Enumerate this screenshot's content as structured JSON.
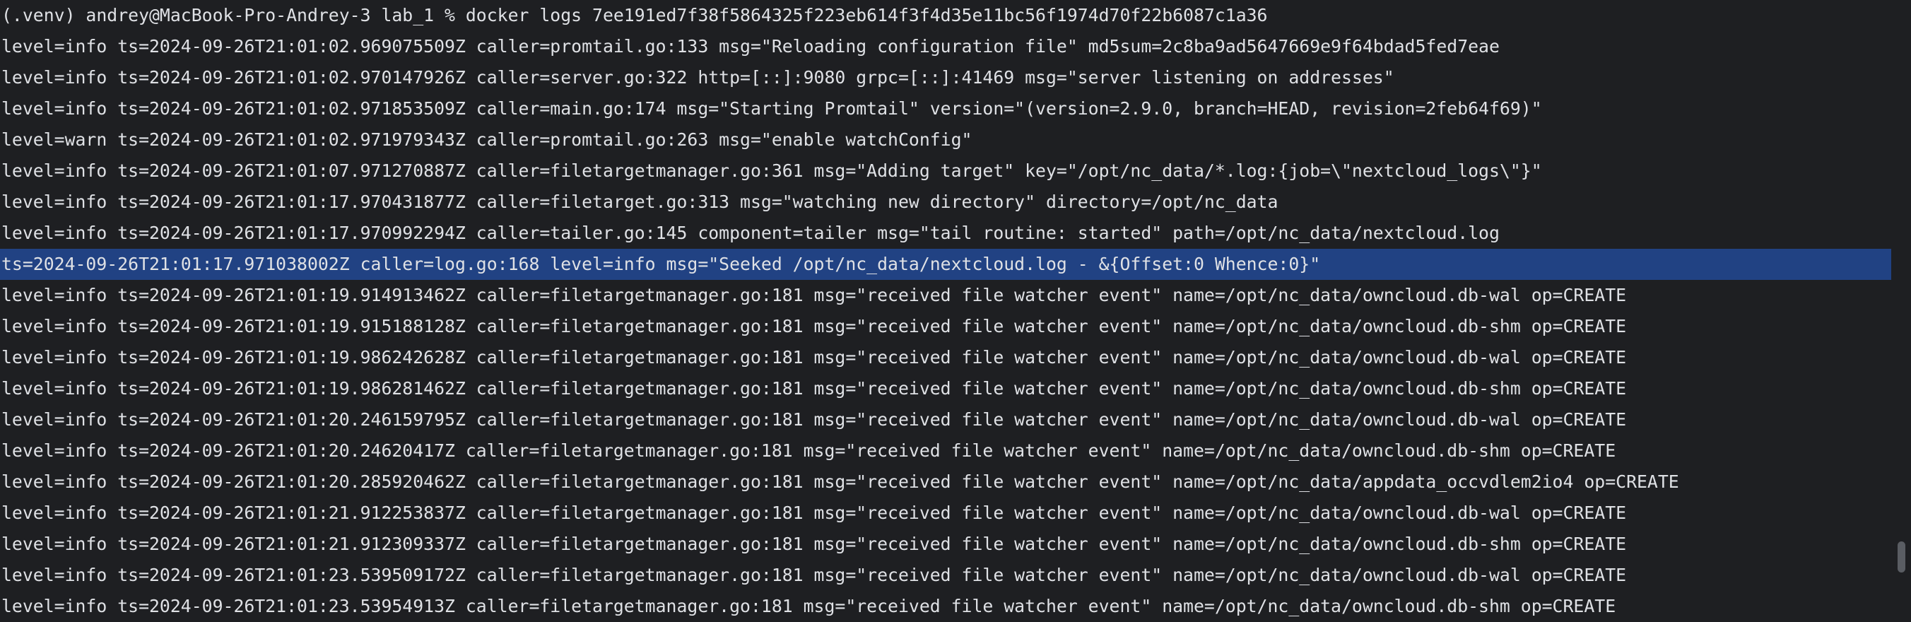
{
  "terminal": {
    "prompt_line": "(.venv) andrey@MacBook-Pro-Andrey-3 lab_1 % docker logs 7ee191ed7f38f5864325f223eb614f3f4d35e11bc56f1974d70f22b6087c1a36",
    "log_lines": [
      "level=info ts=2024-09-26T21:01:02.969075509Z caller=promtail.go:133 msg=\"Reloading configuration file\" md5sum=2c8ba9ad5647669e9f64bdad5fed7eae",
      "level=info ts=2024-09-26T21:01:02.970147926Z caller=server.go:322 http=[::]:9080 grpc=[::]:41469 msg=\"server listening on addresses\"",
      "level=info ts=2024-09-26T21:01:02.971853509Z caller=main.go:174 msg=\"Starting Promtail\" version=\"(version=2.9.0, branch=HEAD, revision=2feb64f69)\"",
      "level=warn ts=2024-09-26T21:01:02.971979343Z caller=promtail.go:263 msg=\"enable watchConfig\"",
      "level=info ts=2024-09-26T21:01:07.971270887Z caller=filetargetmanager.go:361 msg=\"Adding target\" key=\"/opt/nc_data/*.log:{job=\\\"nextcloud_logs\\\"}\"",
      "level=info ts=2024-09-26T21:01:17.970431877Z caller=filetarget.go:313 msg=\"watching new directory\" directory=/opt/nc_data",
      "level=info ts=2024-09-26T21:01:17.970992294Z caller=tailer.go:145 component=tailer msg=\"tail routine: started\" path=/opt/nc_data/nextcloud.log",
      "ts=2024-09-26T21:01:17.971038002Z caller=log.go:168 level=info msg=\"Seeked /opt/nc_data/nextcloud.log - &{Offset:0 Whence:0}\"",
      "level=info ts=2024-09-26T21:01:19.914913462Z caller=filetargetmanager.go:181 msg=\"received file watcher event\" name=/opt/nc_data/owncloud.db-wal op=CREATE",
      "level=info ts=2024-09-26T21:01:19.915188128Z caller=filetargetmanager.go:181 msg=\"received file watcher event\" name=/opt/nc_data/owncloud.db-shm op=CREATE",
      "level=info ts=2024-09-26T21:01:19.986242628Z caller=filetargetmanager.go:181 msg=\"received file watcher event\" name=/opt/nc_data/owncloud.db-wal op=CREATE",
      "level=info ts=2024-09-26T21:01:19.986281462Z caller=filetargetmanager.go:181 msg=\"received file watcher event\" name=/opt/nc_data/owncloud.db-shm op=CREATE",
      "level=info ts=2024-09-26T21:01:20.246159795Z caller=filetargetmanager.go:181 msg=\"received file watcher event\" name=/opt/nc_data/owncloud.db-wal op=CREATE",
      "level=info ts=2024-09-26T21:01:20.24620417Z caller=filetargetmanager.go:181 msg=\"received file watcher event\" name=/opt/nc_data/owncloud.db-shm op=CREATE",
      "level=info ts=2024-09-26T21:01:20.285920462Z caller=filetargetmanager.go:181 msg=\"received file watcher event\" name=/opt/nc_data/appdata_occvdlem2io4 op=CREATE",
      "level=info ts=2024-09-26T21:01:21.912253837Z caller=filetargetmanager.go:181 msg=\"received file watcher event\" name=/opt/nc_data/owncloud.db-wal op=CREATE",
      "level=info ts=2024-09-26T21:01:21.912309337Z caller=filetargetmanager.go:181 msg=\"received file watcher event\" name=/opt/nc_data/owncloud.db-shm op=CREATE",
      "level=info ts=2024-09-26T21:01:23.539509172Z caller=filetargetmanager.go:181 msg=\"received file watcher event\" name=/opt/nc_data/owncloud.db-wal op=CREATE",
      "level=info ts=2024-09-26T21:01:23.53954913Z caller=filetargetmanager.go:181 msg=\"received file watcher event\" name=/opt/nc_data/owncloud.db-shm op=CREATE"
    ],
    "selected_line_index": 7
  },
  "colors": {
    "background": "#1e1f22",
    "text": "#dfe1e5",
    "selection": "#214283"
  }
}
